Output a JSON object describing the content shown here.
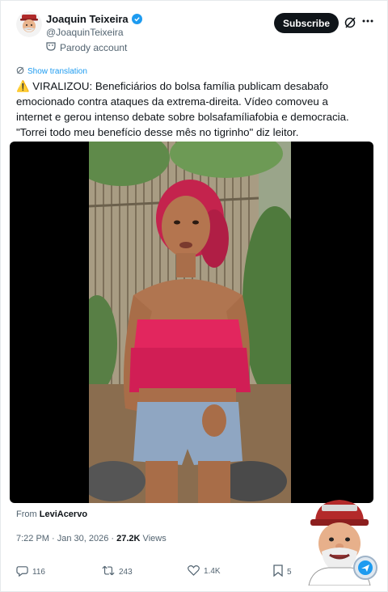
{
  "author": {
    "display_name": "Joaquin Teixeira",
    "handle": "@JoaquinTeixeira",
    "account_label": "Parody account",
    "verified": true
  },
  "header": {
    "subscribe_label": "Subscribe",
    "grok_icon": "grok-slash-icon",
    "more_icon": "more-horizontal-icon"
  },
  "post": {
    "show_translation": "Show translation",
    "lines": [
      "⚠️ VIRALIZOU: Beneficiários do bolsa família publicam desabafo",
      "emocionado contra ataques da extrema-direita. Vídeo comoveu a",
      "internet e gerou intenso debate sobre bolsafamíliafobia e democracia.",
      "\"Torrei todo meu benefício desse mês no tigrinho\" diz leitor."
    ]
  },
  "media": {
    "type": "video",
    "subject": "woman in pink ruffled top and denim shorts in front of bamboo fence"
  },
  "source": {
    "prefix": "From",
    "name": "LeviAcervo"
  },
  "meta": {
    "time_date": "7:22 PM · Jan 30, 2026 · ",
    "views_count": "27.2K",
    "views_label": " Views"
  },
  "actions": {
    "replies": "116",
    "reposts": "243",
    "likes": "1.4K",
    "bookmarks": "5"
  },
  "colors": {
    "accent": "#1d9bf0",
    "text": "#0f1419",
    "secondary": "#536471",
    "button_bg": "#0f1419"
  }
}
